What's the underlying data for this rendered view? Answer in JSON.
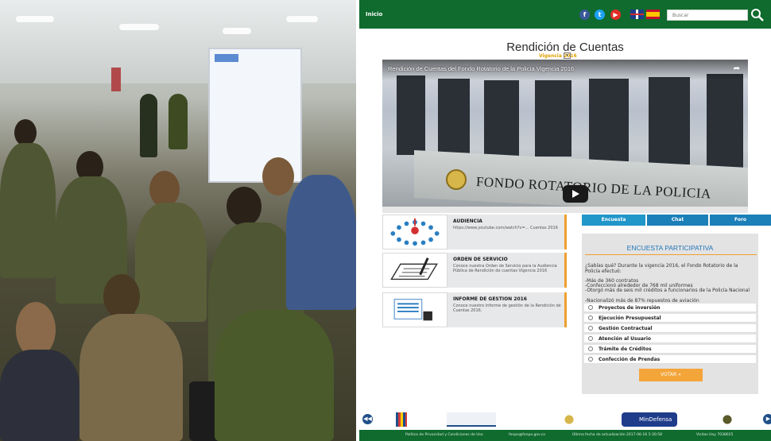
{
  "topbar": {
    "inicio": "Inicio",
    "search_placeholder": "Buscar"
  },
  "social_icons": [
    "facebook-icon",
    "twitter-icon",
    "youtube-icon"
  ],
  "page": {
    "title": "Rendición de Cuentas",
    "vigencia": "Vigencia 2016"
  },
  "video": {
    "title": "Rendición de Cuentas del Fondo Rotatorio de la Policía Vigencia 2016",
    "sign": "FONDO ROTATORIO DE LA POLICIA"
  },
  "cards": [
    {
      "title": "AUDIENCIA",
      "text": "https://www.youtube.com/watch?v=... Cuentas 2016"
    },
    {
      "title": "ORDEN DE SERVICIO",
      "text": "Conoce nuestra Orden de Servicio para la Audiencia Pública de Rendición de cuentas Vigencia 2016"
    },
    {
      "title": "INFORME DE GESTION 2016",
      "text": "Conoce nuestro Informe de gestión de la Rendición de Cuentas 2016."
    }
  ],
  "tabs": {
    "encuesta": "Encuesta",
    "chat": "Chat",
    "foro": "Foro"
  },
  "survey": {
    "title": "ENCUESTA PARTICIPATIVA",
    "intro": "¿Sabías qué? Durante la vigencia 2016, el Fondo Rotatorio de la Policía efectuó:",
    "facts": [
      "-Más de 360 contratos",
      "-Confeccionó alrededor de 768 mil uniformes",
      "-Otorgó más de seis mil créditos a funcionarios de la Policía Nacional",
      "-Nacionalizó más de 87% repuestos de aviación"
    ],
    "options": [
      "Proyectos de inversión",
      "Ejecución Presupuestal",
      "Gestión Contractual",
      "Atención al Usuario",
      "Trámite de Créditos",
      "Confección de Prendas"
    ],
    "vote_label": "VOTAR »"
  },
  "footer": {
    "logo_mindefensa": "MinDefensa",
    "links": [
      "Política de Privacidad y Condiciones de Uso",
      "fonpo@fonpo.gov.co",
      "Última fecha de actualización 2017-06-16 5:30:58",
      "Visitas Hoy 7038025"
    ]
  },
  "colors": {
    "brand_green": "#0f6b2e",
    "accent_orange": "#f0a030",
    "tab_blue": "#1b7fb8",
    "survey_title_blue": "#2276b9"
  }
}
